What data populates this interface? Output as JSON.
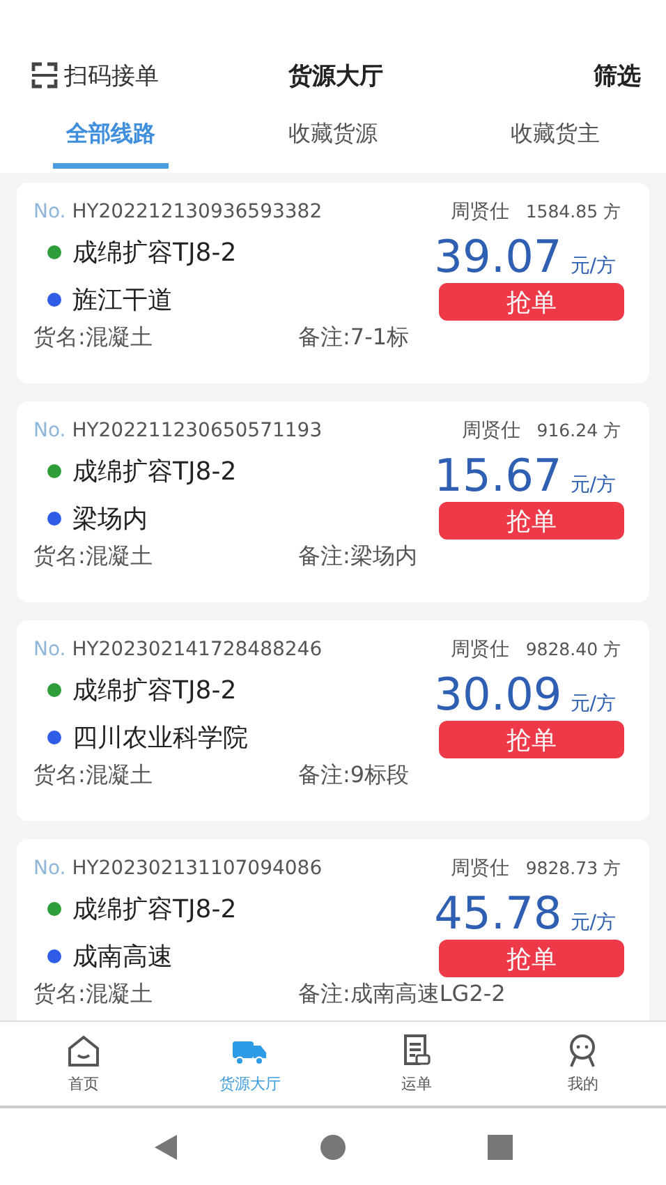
{
  "header": {
    "scan_label": "扫码接单",
    "title": "货源大厅",
    "filter": "筛选"
  },
  "tabs": [
    {
      "label": "全部线路",
      "selected": true
    },
    {
      "label": "收藏货源",
      "selected": false
    },
    {
      "label": "收藏货主",
      "selected": false
    }
  ],
  "orders": [
    {
      "no_prefix": "No.",
      "number": "HY202212130936593382",
      "shipper": "周贤仕",
      "volume": "1584.85 方",
      "stops": [
        {
          "name": "成绵扩容TJ8-2",
          "color": "#2e9e3a"
        },
        {
          "name": "旌江干道",
          "color": "#2f5de8"
        }
      ],
      "price": "39.07",
      "unit": "元/方",
      "action": "抢单",
      "cargo": "货名:混凝土",
      "note": "备注:7-1标"
    },
    {
      "no_prefix": "No.",
      "number": "HY202211230650571193",
      "shipper": "周贤仕",
      "volume": "916.24 方",
      "stops": [
        {
          "name": "成绵扩容TJ8-2",
          "color": "#2e9e3a"
        },
        {
          "name": "梁场内",
          "color": "#2f5de8"
        }
      ],
      "price": "15.67",
      "unit": "元/方",
      "action": "抢单",
      "cargo": "货名:混凝土",
      "note": "备注:梁场内"
    },
    {
      "no_prefix": "No.",
      "number": "HY202302141728488246",
      "shipper": "周贤仕",
      "volume": "9828.40 方",
      "stops": [
        {
          "name": "成绵扩容TJ8-2",
          "color": "#2e9e3a"
        },
        {
          "name": "四川农业科学院",
          "color": "#2f5de8"
        }
      ],
      "price": "30.09",
      "unit": "元/方",
      "action": "抢单",
      "cargo": "货名:混凝土",
      "note": "备注:9标段"
    },
    {
      "no_prefix": "No.",
      "number": "HY202302131107094086",
      "shipper": "周贤仕",
      "volume": "9828.73 方",
      "stops": [
        {
          "name": "成绵扩容TJ8-2",
          "color": "#2e9e3a"
        },
        {
          "name": "成南高速",
          "color": "#2f5de8"
        }
      ],
      "price": "45.78",
      "unit": "元/方",
      "action": "抢单",
      "cargo": "货名:混凝土",
      "note": "备注:成南高速LG2-2"
    }
  ],
  "bottom_nav": [
    {
      "kind": "home",
      "label": "首页",
      "selected": false
    },
    {
      "kind": "truck",
      "label": "货源大厅",
      "selected": true
    },
    {
      "kind": "document",
      "label": "运单",
      "selected": false
    },
    {
      "kind": "person",
      "label": "我的",
      "selected": false
    }
  ]
}
